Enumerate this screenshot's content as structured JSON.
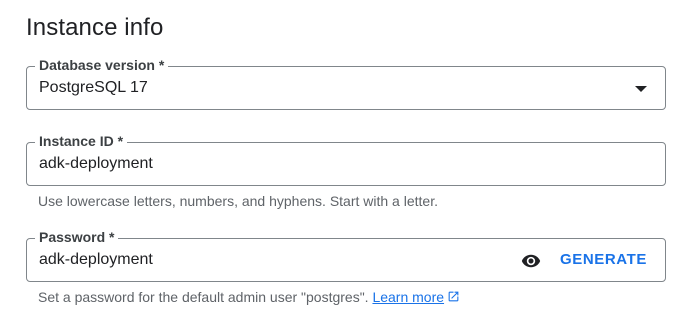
{
  "section": {
    "title": "Instance info"
  },
  "database_version": {
    "label": "Database version *",
    "value": "PostgreSQL 17"
  },
  "instance_id": {
    "label": "Instance ID *",
    "value": "adk-deployment",
    "hint": "Use lowercase letters, numbers, and hyphens. Start with a letter."
  },
  "password": {
    "label": "Password *",
    "value": "adk-deployment",
    "generate_label": "GENERATE",
    "hint": "Set a password for the default admin user \"postgres\".",
    "learn_more_label": "Learn more"
  },
  "icons": {
    "visibility": "eye-icon",
    "dropdown": "arrow-drop-down-icon",
    "external_link": "open-in-new-icon"
  },
  "colors": {
    "accent": "#1a73e8",
    "border": "#80868b",
    "hint_text": "#5f6368",
    "text": "#202124"
  }
}
